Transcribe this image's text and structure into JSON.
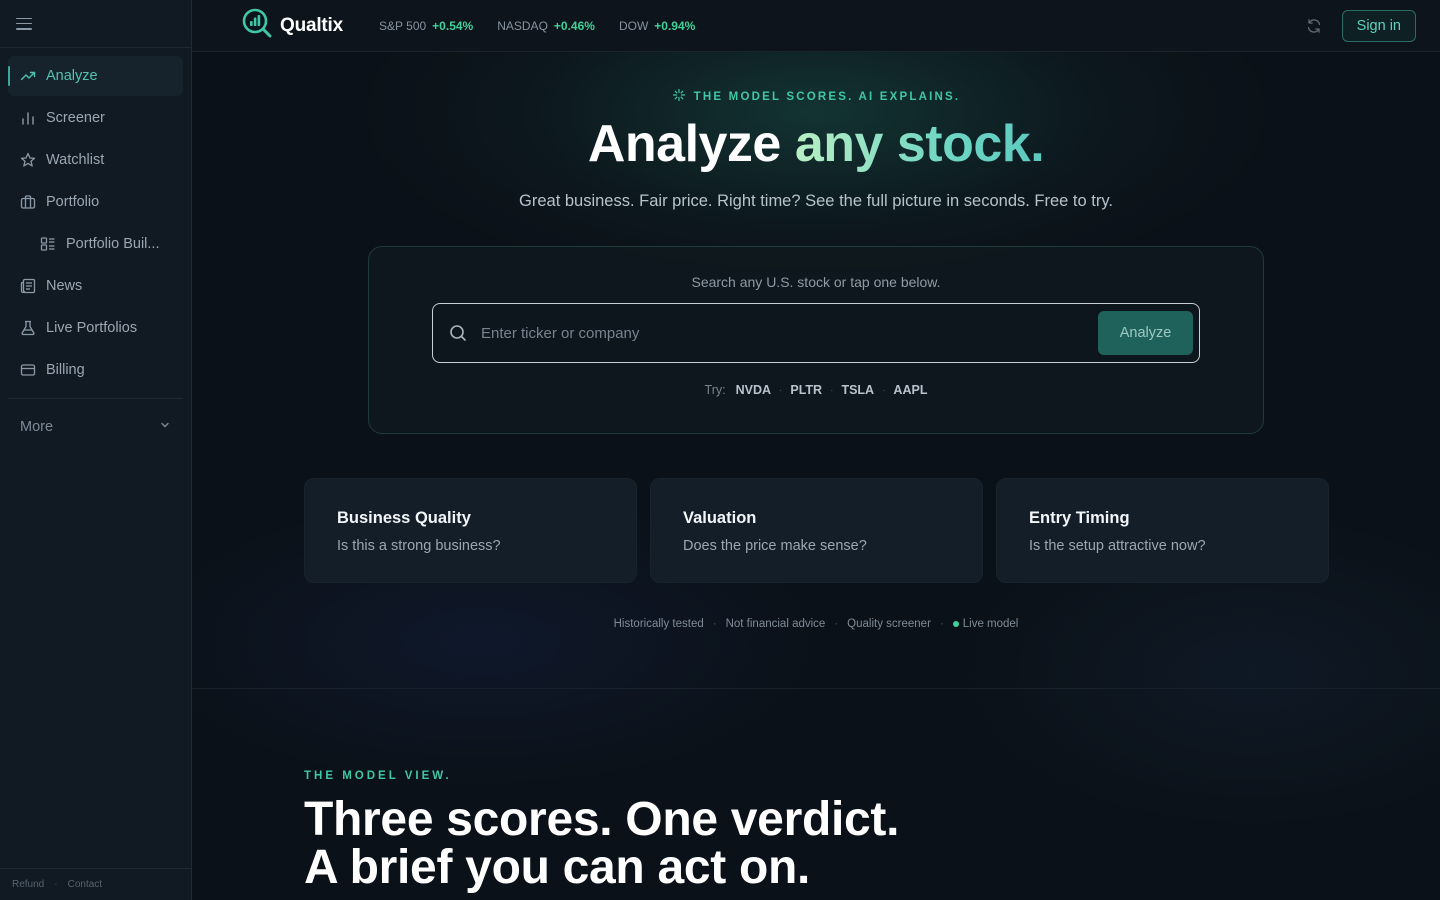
{
  "app": {
    "name": "Qualtix"
  },
  "sidebar": {
    "items": [
      {
        "label": "Analyze",
        "icon": "trending-up-icon",
        "active": true
      },
      {
        "label": "Screener",
        "icon": "bar-chart-icon"
      },
      {
        "label": "Watchlist",
        "icon": "star-icon"
      },
      {
        "label": "Portfolio",
        "icon": "briefcase-icon"
      },
      {
        "label": "Portfolio Buil...",
        "icon": "layout-list-icon",
        "sub": true
      },
      {
        "label": "News",
        "icon": "newspaper-icon"
      },
      {
        "label": "Live Portfolios",
        "icon": "flask-icon"
      },
      {
        "label": "Billing",
        "icon": "credit-card-icon"
      }
    ],
    "more_label": "More",
    "footer": {
      "refund": "Refund",
      "contact": "Contact"
    }
  },
  "topbar": {
    "tickers": [
      {
        "name": "S&P 500",
        "value": "+0.54%"
      },
      {
        "name": "NASDAQ",
        "value": "+0.46%"
      },
      {
        "name": "DOW",
        "value": "+0.94%"
      }
    ],
    "signin_label": "Sign in"
  },
  "hero": {
    "eyebrow": "THE MODEL SCORES. AI EXPLAINS.",
    "title_plain": "Analyze ",
    "title_accent": "any stock.",
    "subtitle": "Great business. Fair price. Right time? See the full picture in seconds. Free to try."
  },
  "search": {
    "hint": "Search any U.S. stock or tap one below.",
    "placeholder": "Enter ticker or company",
    "button_label": "Analyze",
    "try_label": "Try:",
    "suggestions": [
      "NVDA",
      "PLTR",
      "TSLA",
      "AAPL"
    ]
  },
  "features": [
    {
      "title": "Business Quality",
      "desc": "Is this a strong business?"
    },
    {
      "title": "Valuation",
      "desc": "Does the price make sense?"
    },
    {
      "title": "Entry Timing",
      "desc": "Is the setup attractive now?"
    }
  ],
  "trust": [
    "Historically tested",
    "Not financial advice",
    "Quality screener",
    "Live model"
  ],
  "model_section": {
    "eyebrow": "THE MODEL VIEW.",
    "title_line1": "Three scores. One verdict.",
    "title_line2": "A brief you can act on."
  },
  "colors": {
    "accent": "#3fc7a8",
    "positive": "#3fd29a",
    "background": "#0b1118"
  }
}
